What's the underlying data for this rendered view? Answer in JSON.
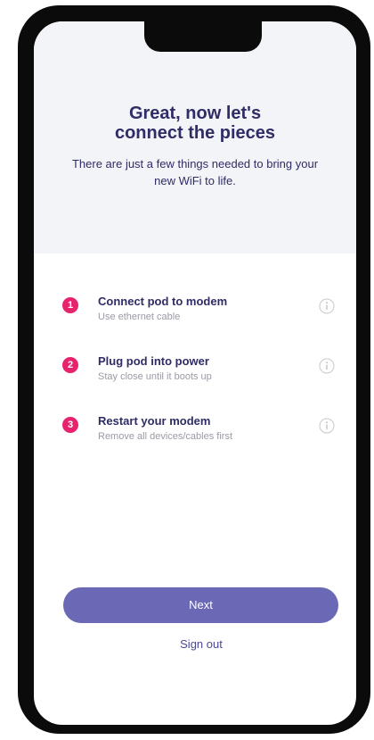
{
  "header": {
    "title_line1": "Great, now let's",
    "title_line2": "connect the pieces",
    "subtitle": "There are just a few things needed to bring your new WiFi to life."
  },
  "steps": [
    {
      "number": "1",
      "title": "Connect pod to modem",
      "subtitle": "Use ethernet cable",
      "icon": "info-icon"
    },
    {
      "number": "2",
      "title": "Plug pod into power",
      "subtitle": "Stay close until it boots up",
      "icon": "info-icon"
    },
    {
      "number": "3",
      "title": "Restart your modem",
      "subtitle": "Remove all devices/cables first",
      "icon": "info-icon"
    }
  ],
  "actions": {
    "next_label": "Next",
    "signout_label": "Sign out"
  },
  "colors": {
    "accent": "#6b68b5",
    "step_badge": "#e8236e",
    "text_primary": "#2f2c66",
    "text_secondary": "#9a9aa6",
    "header_bg": "#f3f4f8"
  }
}
